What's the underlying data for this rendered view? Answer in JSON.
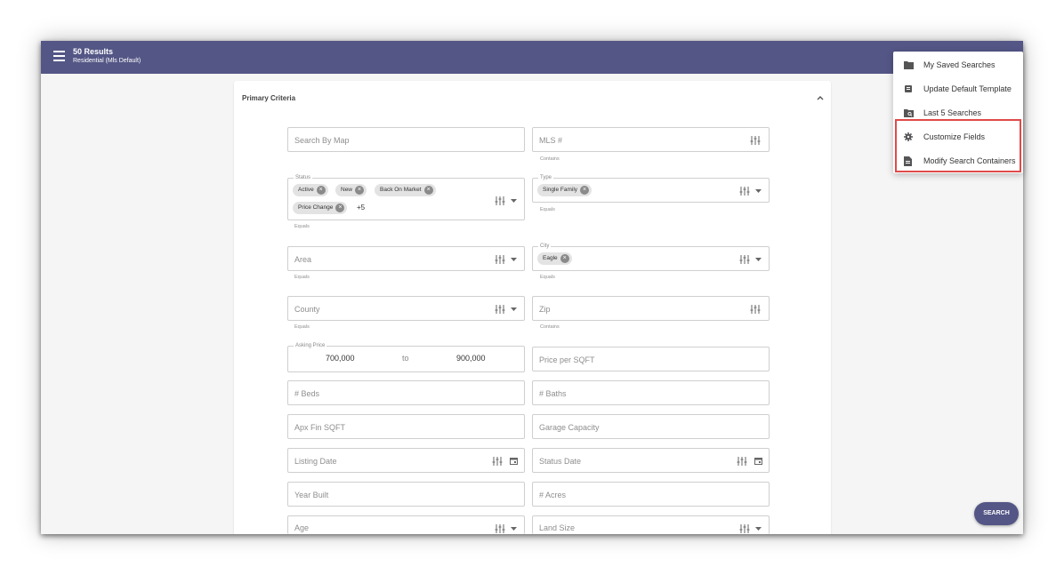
{
  "header": {
    "results": "50 Results",
    "subtitle": "Residential (Mls Default)"
  },
  "panel": {
    "title": "Primary Criteria"
  },
  "fields": {
    "search_by_map": "Search By Map",
    "mls": {
      "placeholder": "MLS #",
      "helper": "Contains"
    },
    "status": {
      "legend": "Status",
      "chips": [
        "Active",
        "New",
        "Back On Market",
        "Price Change"
      ],
      "more": "+5",
      "helper": "Equals"
    },
    "type": {
      "legend": "Type",
      "chips": [
        "Single Family"
      ],
      "helper": "Equals"
    },
    "area": {
      "placeholder": "Area",
      "helper": "Equals"
    },
    "city": {
      "legend": "City",
      "chips": [
        "Eagle"
      ],
      "helper": "Equals"
    },
    "county": {
      "placeholder": "County",
      "helper": "Equals"
    },
    "zip": {
      "placeholder": "Zip",
      "helper": "Contains"
    },
    "asking_price": {
      "legend": "Asking Price",
      "min": "700,000",
      "to": "to",
      "max": "900,000"
    },
    "price_per_sqft": "Price per SQFT",
    "beds": "# Beds",
    "baths": "# Baths",
    "apx_fin_sqft": "Apx Fin SQFT",
    "garage_capacity": "Garage Capacity",
    "listing_date": "Listing Date",
    "status_date": "Status Date",
    "year_built": "Year Built",
    "acres": "# Acres",
    "age": "Age",
    "land_size": "Land Size"
  },
  "menu": {
    "items": [
      {
        "label": "My Saved Searches",
        "icon": "folder-icon"
      },
      {
        "label": "Update Default Template",
        "icon": "template-icon"
      },
      {
        "label": "Last 5 Searches",
        "icon": "folder-search-icon"
      },
      {
        "label": "Customize Fields",
        "icon": "gear-icon"
      },
      {
        "label": "Modify Search Containers",
        "icon": "document-icon"
      }
    ]
  },
  "search_button": "SEARCH",
  "colors": {
    "topbar": "#545686",
    "highlight": "#e04a4a",
    "chip": "#e3e3e3"
  }
}
